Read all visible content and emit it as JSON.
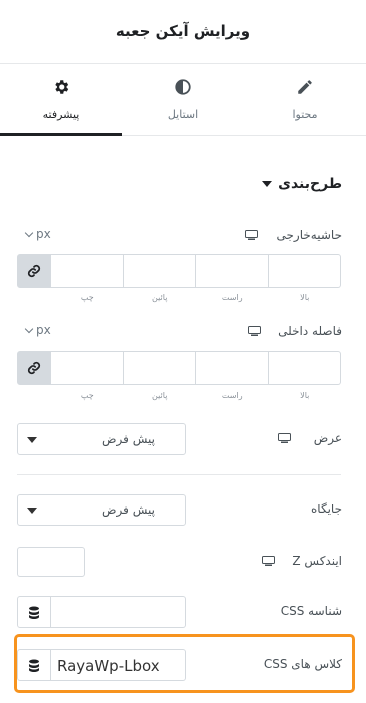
{
  "header": {
    "title": "ویرایش آیکن جعبه"
  },
  "tabs": [
    {
      "label": "پیشرفته",
      "icon": "gear-icon",
      "active": true
    },
    {
      "label": "استایل",
      "icon": "contrast-icon",
      "active": false
    },
    {
      "label": "محتوا",
      "icon": "pencil-icon",
      "active": false
    }
  ],
  "layout_section": {
    "title": "طرح‌بندی"
  },
  "margin": {
    "label": "حاشیه‌خارجی",
    "unit": "px",
    "sides": [
      "بالا",
      "راست",
      "پائین",
      "چپ"
    ]
  },
  "padding": {
    "label": "فاصله داخلی",
    "unit": "px",
    "sides": [
      "بالا",
      "راست",
      "پائین",
      "چپ"
    ]
  },
  "width": {
    "label": "عرض",
    "value": "پیش فرض"
  },
  "position": {
    "label": "جایگاه",
    "value": "پیش فرض"
  },
  "zindex": {
    "label": "ایندکس Z",
    "value": ""
  },
  "css_id": {
    "label": "شناسه CSS",
    "value": ""
  },
  "css_classes": {
    "label": "کلاس های CSS",
    "value": "RayaWp-Lbox"
  },
  "colors": {
    "highlight": "#f7931e",
    "border": "#d5dadf",
    "active_tab": "#1f2124"
  }
}
